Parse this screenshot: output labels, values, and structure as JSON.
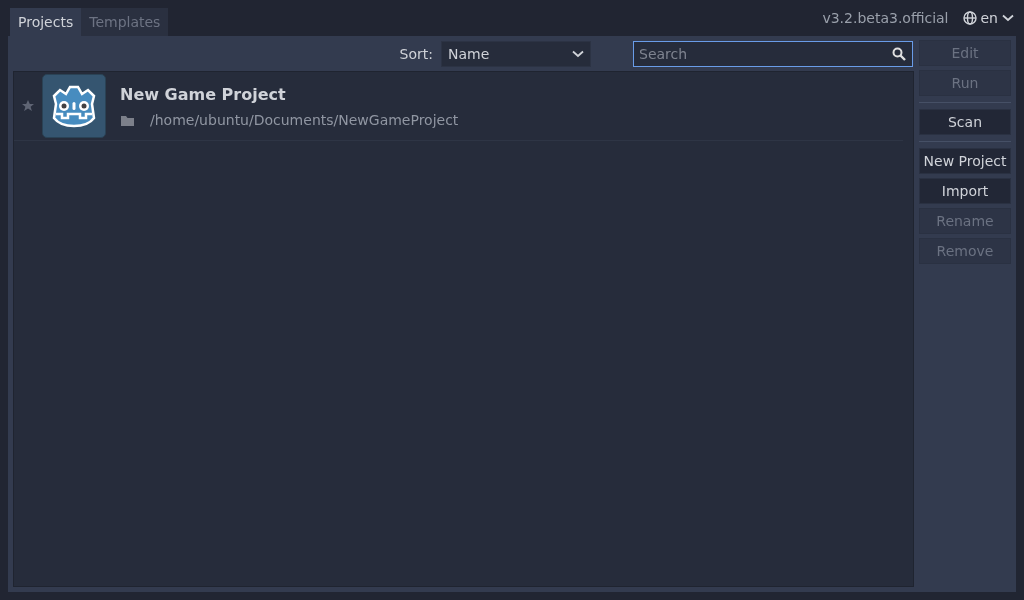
{
  "tabs": [
    {
      "label": "Projects",
      "selected": true
    },
    {
      "label": "Templates",
      "selected": false
    }
  ],
  "version": "v3.2.beta3.official",
  "language": {
    "label": "en"
  },
  "sort": {
    "label": "Sort:",
    "value": "Name"
  },
  "search": {
    "placeholder": "Search"
  },
  "projects": [
    {
      "name": "New Game Project",
      "path": "/home/ubuntu/Documents/NewGameProject",
      "favorite": false
    }
  ],
  "button_groups": [
    [
      {
        "label": "Edit",
        "disabled": true
      },
      {
        "label": "Run",
        "disabled": true
      }
    ],
    [
      {
        "label": "Scan",
        "disabled": false
      }
    ],
    [
      {
        "label": "New Project",
        "disabled": false
      },
      {
        "label": "Import",
        "disabled": false
      },
      {
        "label": "Rename",
        "disabled": true
      },
      {
        "label": "Remove",
        "disabled": true
      }
    ]
  ]
}
